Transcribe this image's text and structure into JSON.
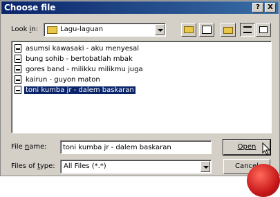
{
  "title": "Choose file",
  "titlebar_buttons": {
    "help": "?",
    "close": "X"
  },
  "lookin": {
    "label_pre": "Look ",
    "label_key": "i",
    "label_post": "n:",
    "value": "Lagu-laguan"
  },
  "toolbar": [
    "folder-up-icon",
    "desktop-icon",
    "new-folder-icon",
    "list-view-icon",
    "details-view-icon"
  ],
  "files": [
    "asumsi kawasaki - aku menyesal",
    "bung sohib - bertobatlah mbak",
    "gores band - milikku milikmu juga",
    "kairun - guyon maton",
    "toni kumba jr - dalem baskaran"
  ],
  "selected_index": 4,
  "filename": {
    "label_pre": "File ",
    "label_key": "n",
    "label_post": "ame:",
    "value": "toni kumba jr - dalem baskaran"
  },
  "filetype": {
    "label_pre": "Files of ",
    "label_key": "t",
    "label_post": "ype:",
    "value": "All Files (*.*)"
  },
  "buttons": {
    "open": "Open",
    "cancel": "Cancel"
  },
  "colors": {
    "title_start": "#0a246a",
    "title_end": "#3a6ea5",
    "face": "#d4d0c8",
    "selection": "#0a246a"
  }
}
